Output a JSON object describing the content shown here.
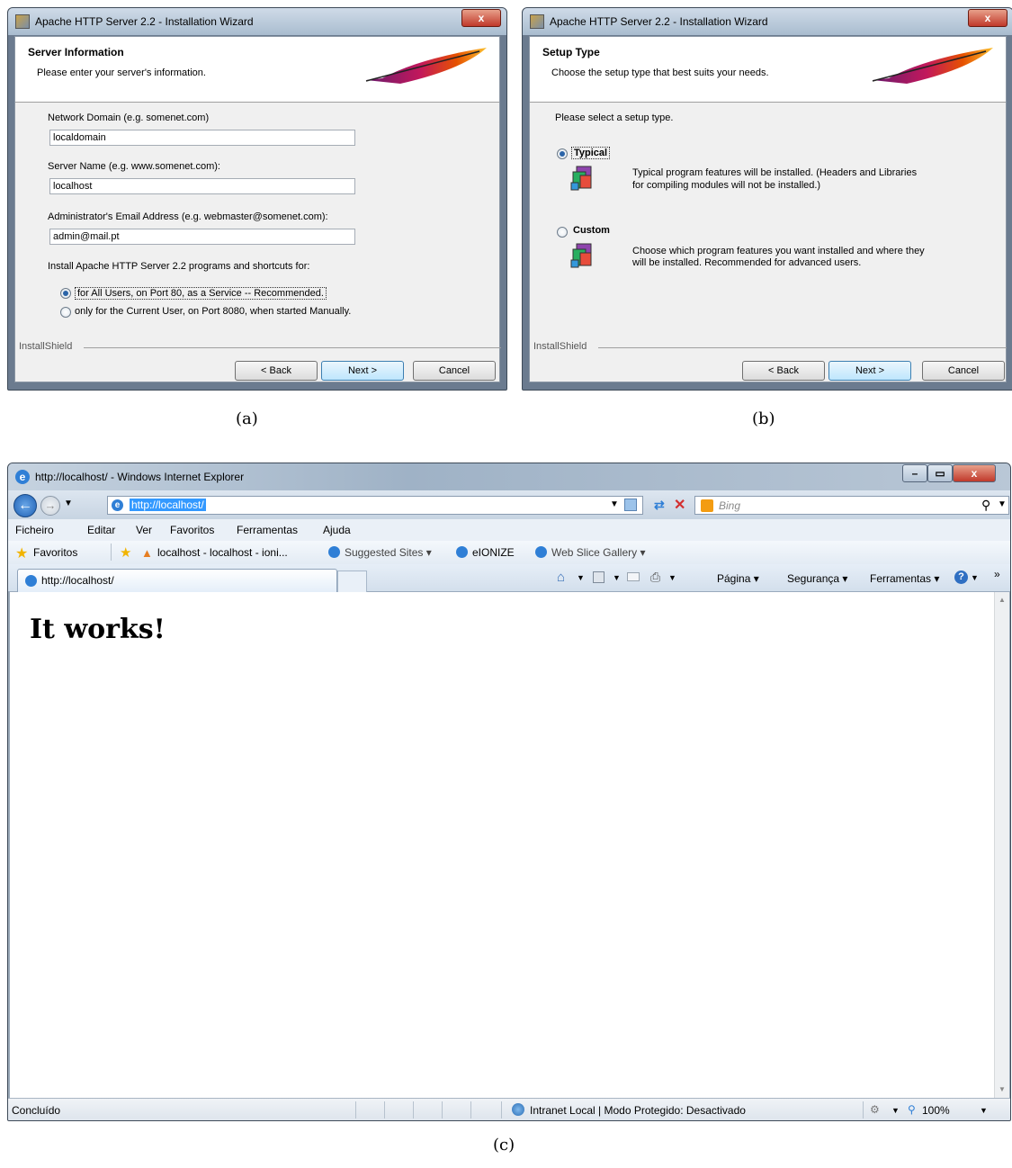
{
  "wizard_a": {
    "window_title": "Apache HTTP Server 2.2 - Installation Wizard",
    "close_glyph": "x",
    "header_title": "Server Information",
    "header_subtitle": "Please enter your server's information.",
    "domain_label": "Network Domain (e.g. somenet.com)",
    "domain_value": "localdomain",
    "server_label": "Server Name (e.g. www.somenet.com):",
    "server_value": "localhost",
    "email_label": "Administrator's Email Address (e.g. webmaster@somenet.com):",
    "email_value": "admin@mail.pt",
    "install_for_label": "Install Apache HTTP Server 2.2 programs and shortcuts for:",
    "radio_all_users": "for All Users, on Port 80, as a Service -- Recommended.",
    "radio_current_user": "only for the Current User, on Port 8080, when started Manually.",
    "selected_option": "all_users",
    "installshield": "InstallShield",
    "back_label": "< Back",
    "next_label": "Next >",
    "cancel_label": "Cancel"
  },
  "wizard_b": {
    "window_title": "Apache HTTP Server 2.2 - Installation Wizard",
    "close_glyph": "x",
    "header_title": "Setup Type",
    "header_subtitle": "Choose the setup type that best suits your needs.",
    "prompt": "Please select a setup type.",
    "typical_label": "Typical",
    "typical_desc_1": "Typical program features will be installed.  (Headers and Libraries",
    "typical_desc_2": "for compiling modules will not be installed.)",
    "custom_label": "Custom",
    "custom_desc_1": "Choose which program features you want installed and where they",
    "custom_desc_2": "will be installed. Recommended for advanced users.",
    "selected_option": "typical",
    "installshield": "InstallShield",
    "back_label": "< Back",
    "next_label": "Next >",
    "cancel_label": "Cancel"
  },
  "captions": {
    "a": "(a)",
    "b": "(b)",
    "c": "(c)"
  },
  "browser": {
    "window_title": "http://localhost/ - Windows Internet Explorer",
    "window_controls": {
      "minimize": "–",
      "maximize": "▭",
      "close": "x"
    },
    "address": "http://localhost/",
    "search_placeholder": "Bing",
    "menu": [
      "Ficheiro",
      "Editar",
      "Ver",
      "Favoritos",
      "Ferramentas",
      "Ajuda"
    ],
    "favorites_label": "Favoritos",
    "fav_items": [
      "localhost - localhost - ioni...",
      "Suggested Sites ▾",
      "eIONIZE",
      "Web Slice Gallery ▾"
    ],
    "tab_title": "http://localhost/",
    "commands": {
      "page": "Página ▾",
      "security": "Segurança ▾",
      "tools": "Ferramentas ▾",
      "chevron": "»"
    },
    "page_heading": "It works!",
    "status_left": "Concluído",
    "status_zone": "Intranet Local | Modo Protegido: Desactivado",
    "zoom": "100%"
  },
  "colors": {
    "close_red": "#c0392b",
    "ie_blue": "#2f7fd6",
    "link_highlight": "#3399ff"
  }
}
